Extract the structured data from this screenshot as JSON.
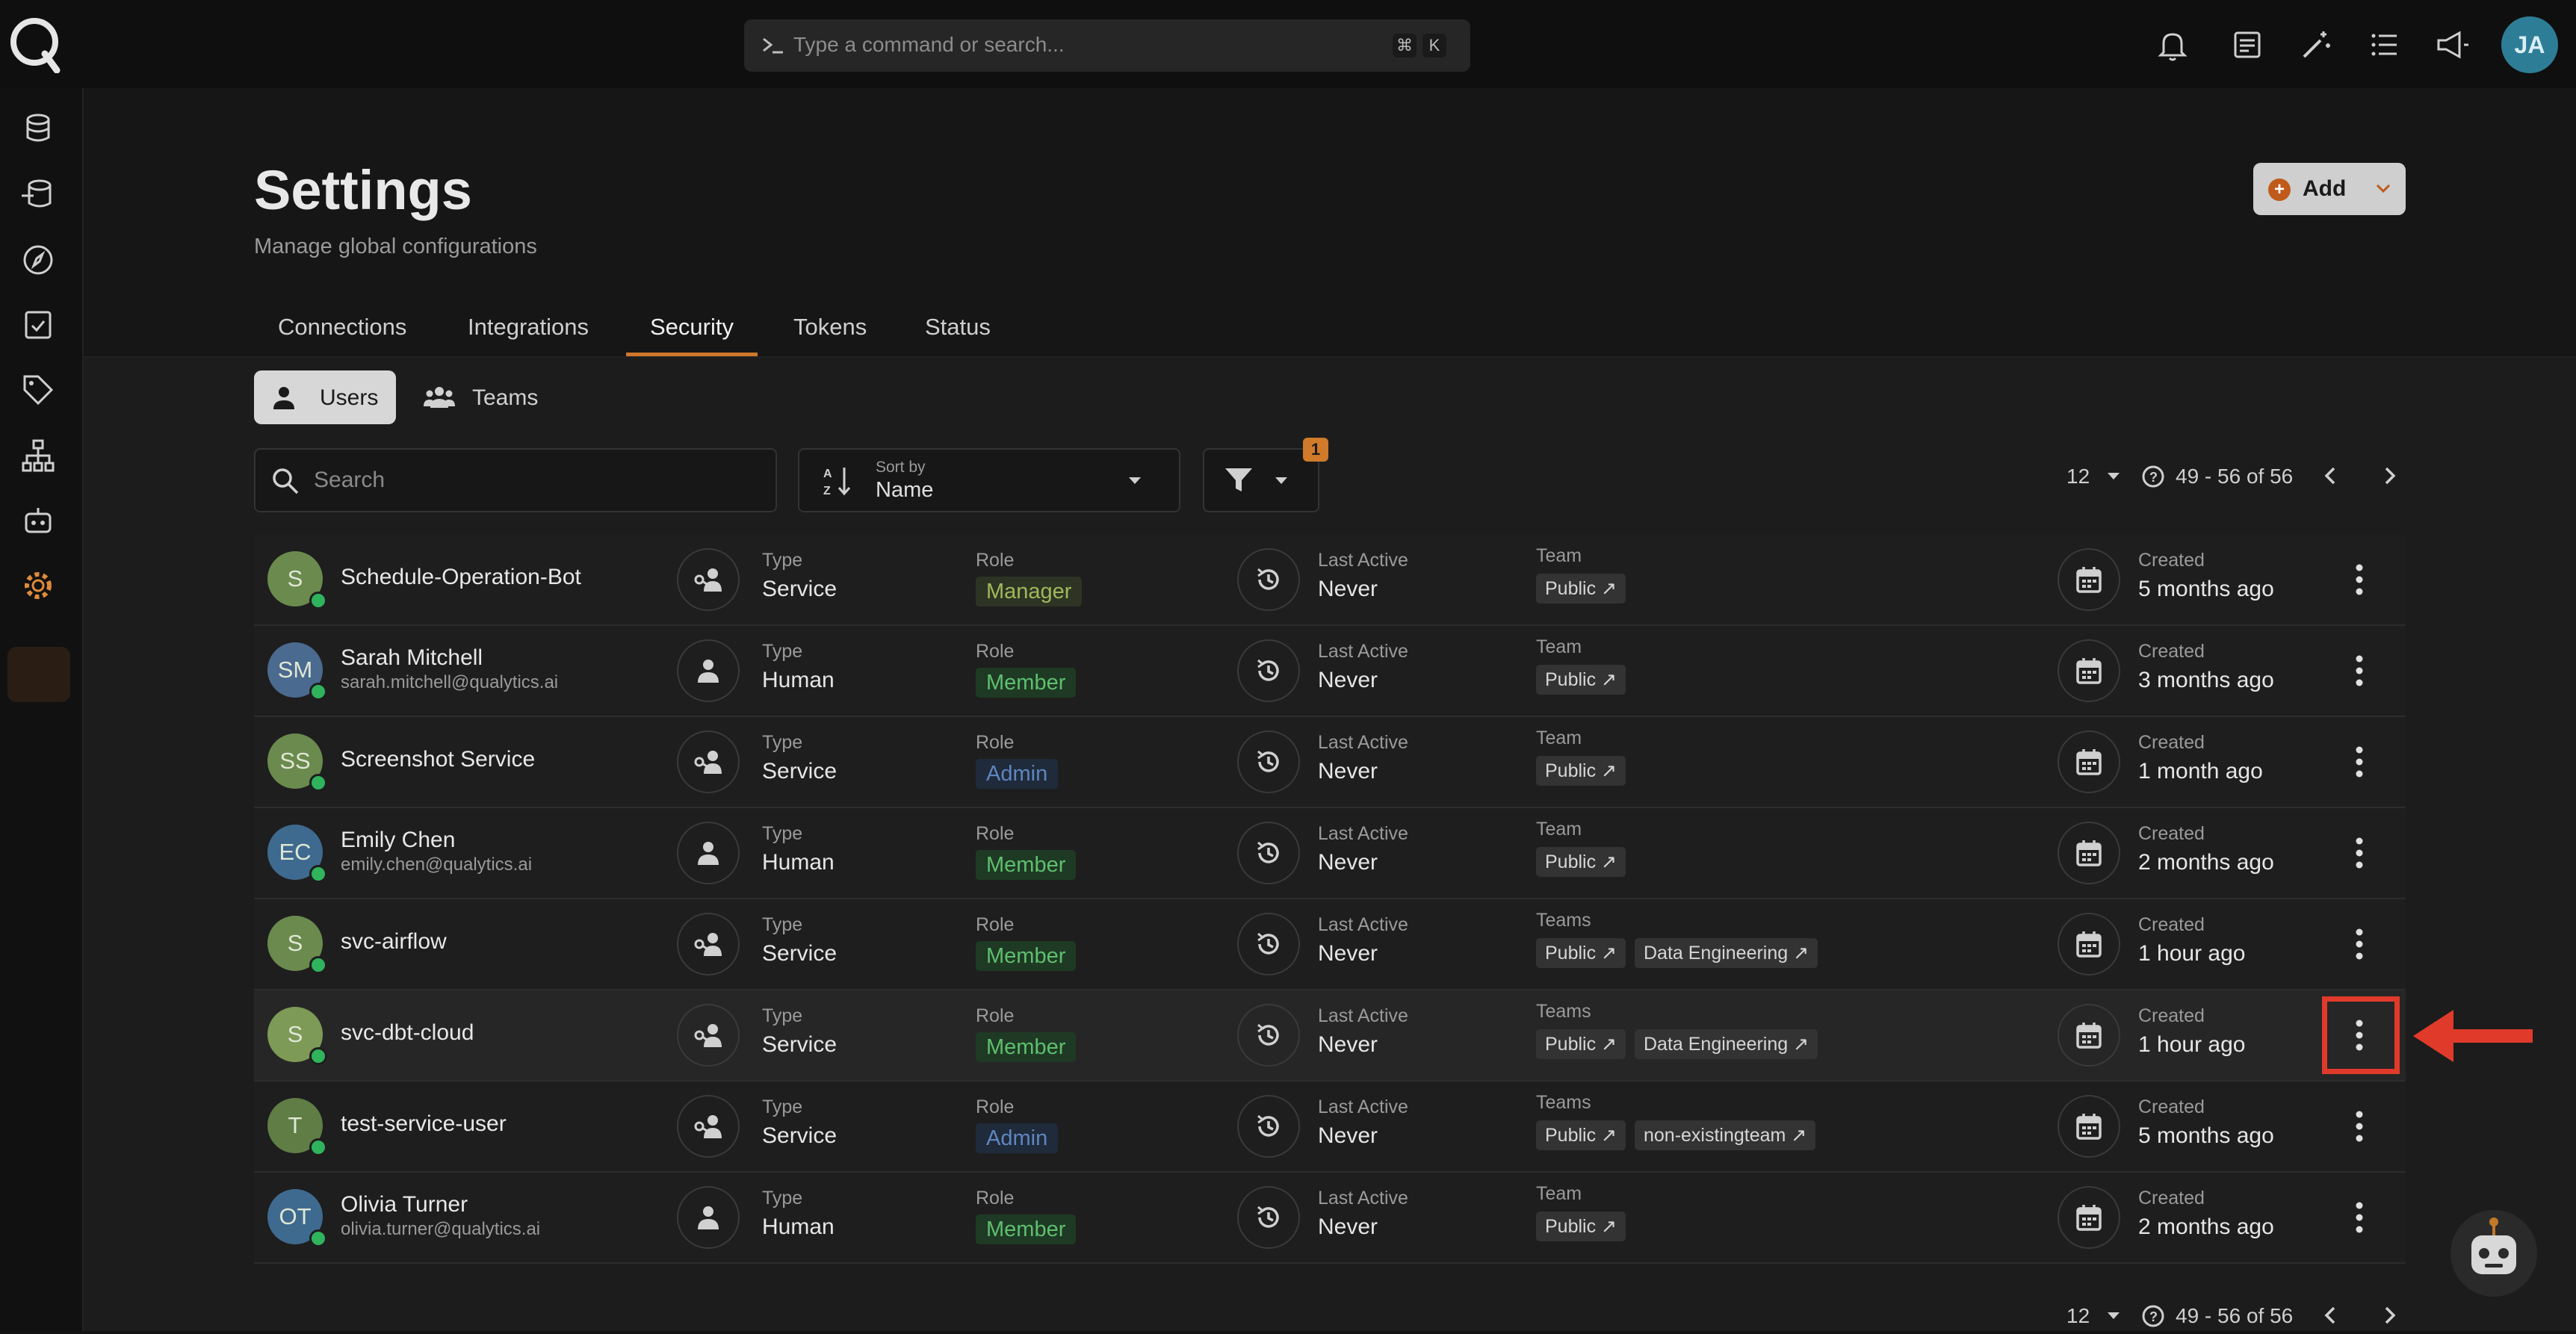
{
  "command_bar": {
    "placeholder": "Type a command or search...",
    "kbd_1": "⌘",
    "kbd_2": "K"
  },
  "user_avatar": "JA",
  "page": {
    "title": "Settings",
    "subtitle": "Manage global configurations",
    "add_label": "Add"
  },
  "tabs": [
    "Connections",
    "Integrations",
    "Security",
    "Tokens",
    "Status"
  ],
  "active_tab": "Security",
  "segments": {
    "users": "Users",
    "teams": "Teams"
  },
  "search": {
    "placeholder": "Search"
  },
  "sort": {
    "caption": "Sort by",
    "value": "Name"
  },
  "filter": {
    "badge": "1"
  },
  "pager": {
    "page_size": "12",
    "range": "49 - 56 of 56"
  },
  "labels": {
    "type": "Type",
    "role": "Role",
    "last_active": "Last Active",
    "created": "Created"
  },
  "users": [
    {
      "initials": "S",
      "avatar_color": "#6b8a4e",
      "name": "Schedule-Operation-Bot",
      "email": "",
      "type": "Service",
      "role": "Manager",
      "role_kind": "manager",
      "last_active": "Never",
      "team_label": "Team",
      "teams": [
        "Public ↗"
      ],
      "created": "5 months ago"
    },
    {
      "initials": "SM",
      "avatar_color": "#4a6a8f",
      "name": "Sarah Mitchell",
      "email": "sarah.mitchell@qualytics.ai",
      "type": "Human",
      "role": "Member",
      "role_kind": "member",
      "last_active": "Never",
      "team_label": "Team",
      "teams": [
        "Public ↗"
      ],
      "created": "3 months ago"
    },
    {
      "initials": "SS",
      "avatar_color": "#6b8a4e",
      "name": "Screenshot Service",
      "email": "",
      "type": "Service",
      "role": "Admin",
      "role_kind": "admin",
      "last_active": "Never",
      "team_label": "Team",
      "teams": [
        "Public ↗"
      ],
      "created": "1 month ago"
    },
    {
      "initials": "EC",
      "avatar_color": "#3f6a8f",
      "name": "Emily Chen",
      "email": "emily.chen@qualytics.ai",
      "type": "Human",
      "role": "Member",
      "role_kind": "member",
      "last_active": "Never",
      "team_label": "Team",
      "teams": [
        "Public ↗"
      ],
      "created": "2 months ago"
    },
    {
      "initials": "S",
      "avatar_color": "#6b8a4e",
      "name": "svc-airflow",
      "email": "",
      "type": "Service",
      "role": "Member",
      "role_kind": "member",
      "last_active": "Never",
      "team_label": "Teams",
      "teams": [
        "Public ↗",
        "Data Engineering ↗"
      ],
      "created": "1 hour ago"
    },
    {
      "initials": "S",
      "avatar_color": "#7d9a56",
      "name": "svc-dbt-cloud",
      "email": "",
      "type": "Service",
      "role": "Member",
      "role_kind": "member",
      "last_active": "Never",
      "team_label": "Teams",
      "teams": [
        "Public ↗",
        "Data Engineering ↗"
      ],
      "created": "1 hour ago"
    },
    {
      "initials": "T",
      "avatar_color": "#5f7d45",
      "name": "test-service-user",
      "email": "",
      "type": "Service",
      "role": "Admin",
      "role_kind": "admin",
      "last_active": "Never",
      "team_label": "Teams",
      "teams": [
        "Public ↗",
        "non-existingteam ↗"
      ],
      "created": "5 months ago"
    },
    {
      "initials": "OT",
      "avatar_color": "#3f6a8f",
      "name": "Olivia Turner",
      "email": "olivia.turner@qualytics.ai",
      "type": "Human",
      "role": "Member",
      "role_kind": "member",
      "last_active": "Never",
      "team_label": "Team",
      "teams": [
        "Public ↗"
      ],
      "created": "2 months ago"
    }
  ],
  "highlighted_row": 5,
  "icons": {
    "top": [
      "bell-icon",
      "notes-icon",
      "magic-wand-icon",
      "list-icon",
      "megaphone-icon"
    ],
    "sidebar": [
      "database-icon",
      "datastore-icon",
      "compass-icon",
      "checklist-icon",
      "tag-icon",
      "hierarchy-icon",
      "robot-icon",
      "gear-icon"
    ]
  },
  "colors": {
    "accent": "#d0782a",
    "annotation": "#e03a2a"
  }
}
